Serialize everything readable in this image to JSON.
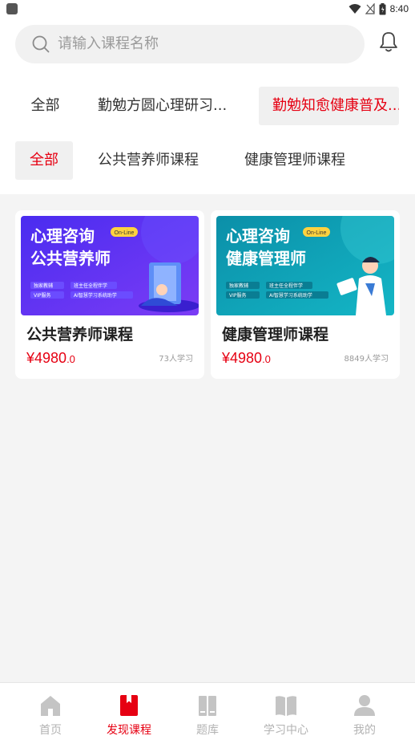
{
  "status_bar": {
    "time": "8:40"
  },
  "search": {
    "placeholder": "请输入课程名称"
  },
  "category_row1": [
    {
      "label": "全部",
      "active": false
    },
    {
      "label": "勤勉方圆心理研习...",
      "active": false
    },
    {
      "label": "勤勉知愈健康普及...",
      "active": true
    }
  ],
  "category_row2": [
    {
      "label": "全部",
      "active": true
    },
    {
      "label": "公共营养师课程",
      "active": false
    },
    {
      "label": "健康管理师课程",
      "active": false
    }
  ],
  "courses": [
    {
      "banner_title_line1": "心理咨询",
      "banner_title_line2": "公共营养师",
      "banner_badge": "On-Line",
      "banner_tags": [
        "独家教辅",
        "班主任全程伴学",
        "VIP服务",
        "AI智慧学习系统助学"
      ],
      "title": "公共营养师课程",
      "price_int": "¥4980",
      "price_dec": ".0",
      "students": "73人学习"
    },
    {
      "banner_title_line1": "心理咨询",
      "banner_title_line2": "健康管理师",
      "banner_badge": "On-Line",
      "banner_tags": [
        "独家教辅",
        "班主任全程伴学",
        "VIP服务",
        "AI智慧学习系统助学"
      ],
      "title": "健康管理师课程",
      "price_int": "¥4980",
      "price_dec": ".0",
      "students": "8849人学习"
    }
  ],
  "tabbar": [
    {
      "label": "首页",
      "icon": "home-icon",
      "active": false
    },
    {
      "label": "发现课程",
      "icon": "bookmark-icon",
      "active": true
    },
    {
      "label": "题库",
      "icon": "question-bank-icon",
      "active": false
    },
    {
      "label": "学习中心",
      "icon": "open-book-icon",
      "active": false
    },
    {
      "label": "我的",
      "icon": "user-icon",
      "active": false
    }
  ],
  "colors": {
    "accent": "#e60012",
    "inactive": "#b3b3b3",
    "background": "#f4f4f4"
  }
}
